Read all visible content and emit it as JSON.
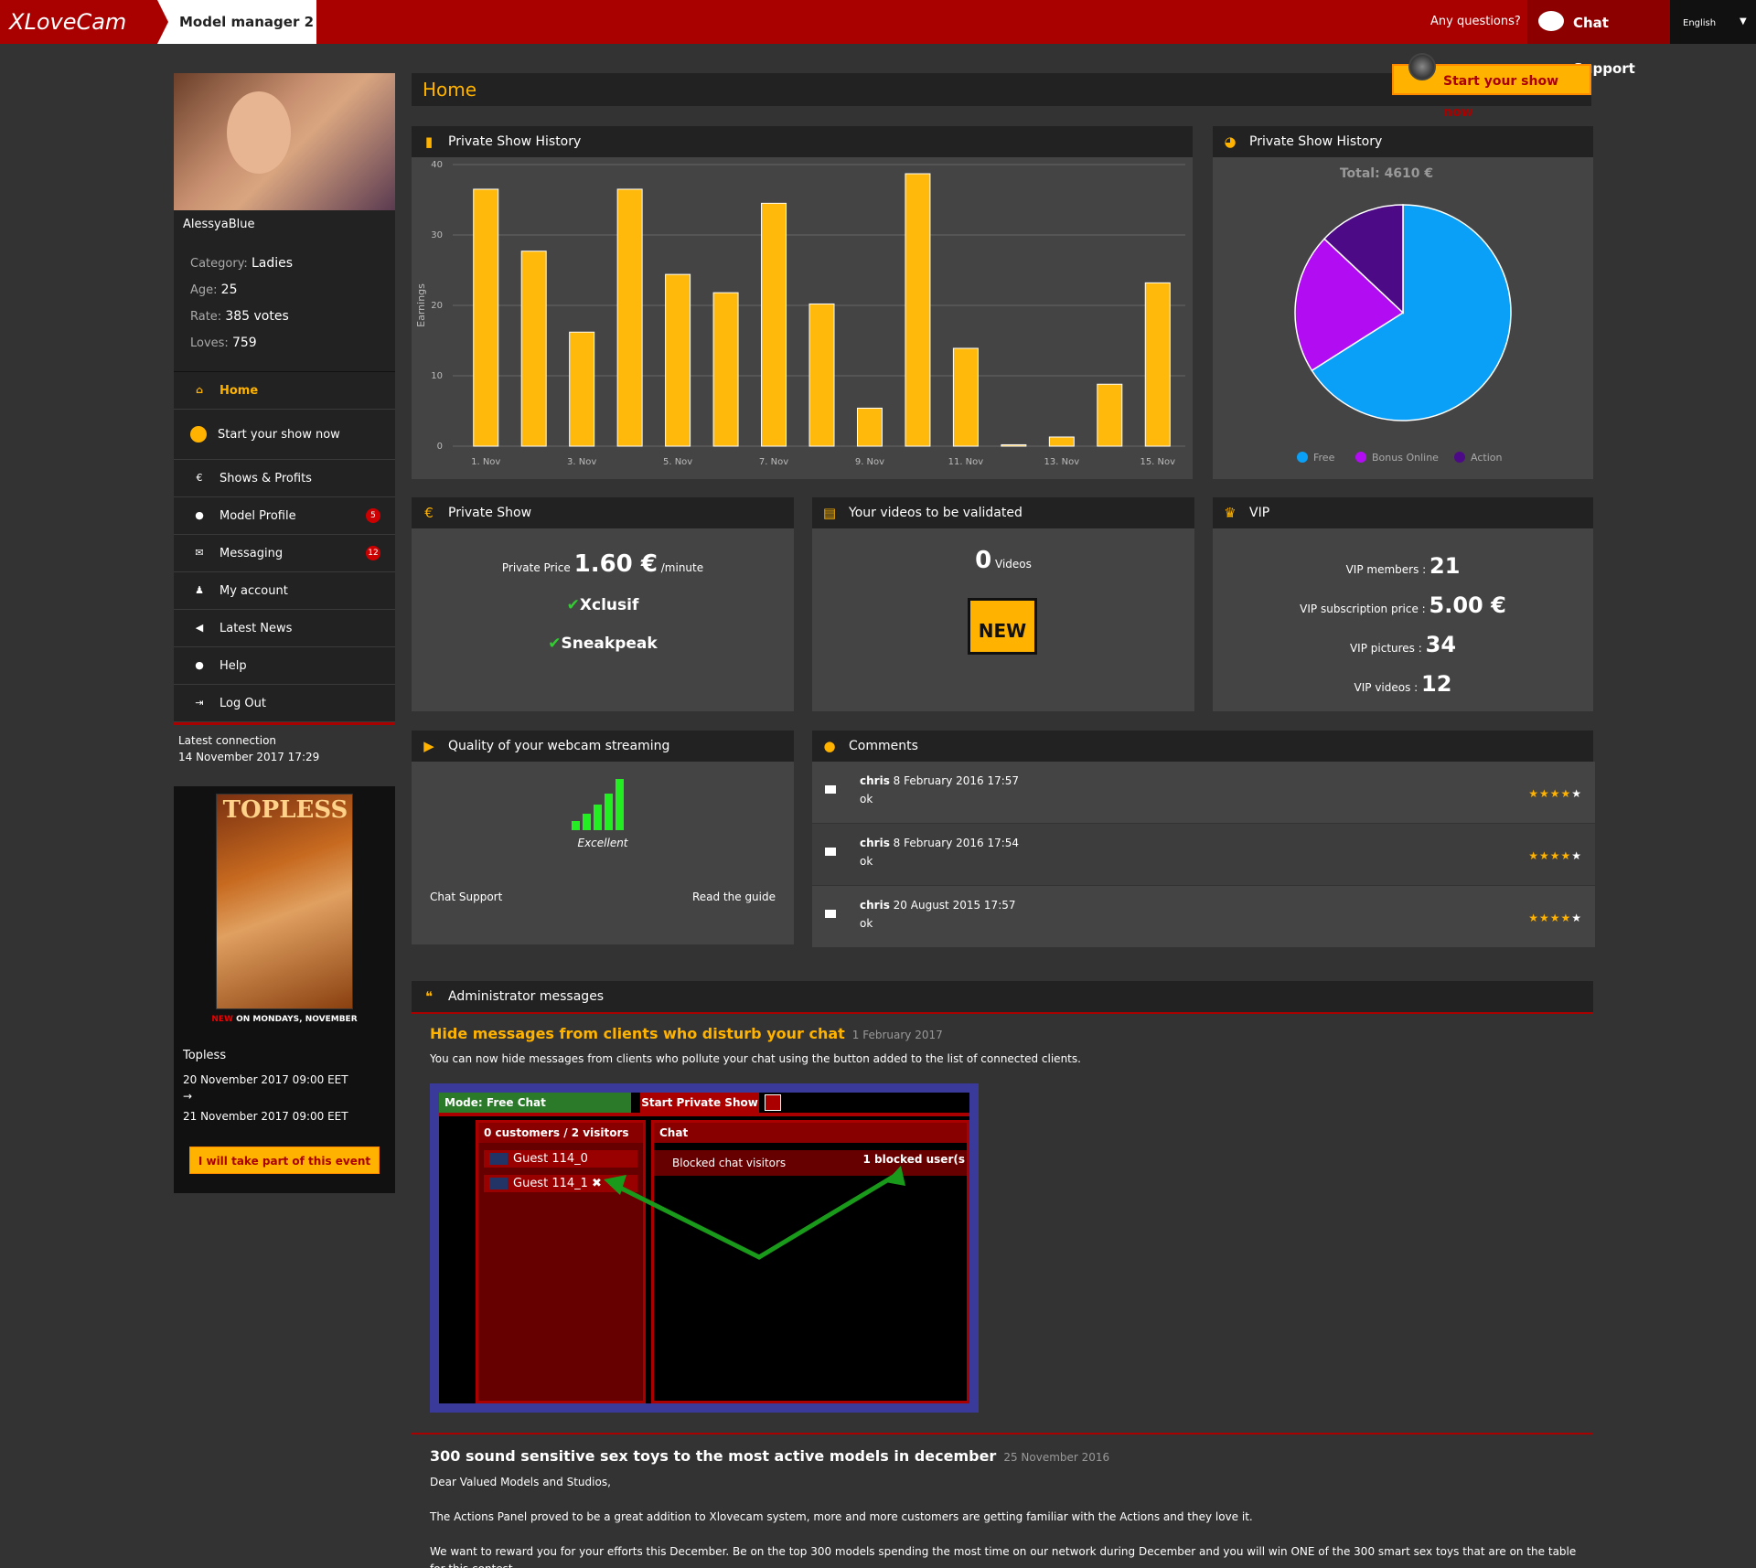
{
  "header": {
    "logo": "XLoveCam",
    "tab": "Model manager 2",
    "any_questions": "Any questions?",
    "chat_support": "Chat Support",
    "language": "English"
  },
  "profile": {
    "name": "AlessyaBlue",
    "category_label": "Category:",
    "category": "Ladies",
    "age_label": "Age:",
    "age": "25",
    "rate_label": "Rate:",
    "rate": "385 votes",
    "loves_label": "Loves:",
    "loves": "759"
  },
  "nav": [
    {
      "label": "Home",
      "icon": "home-icon"
    },
    {
      "label": "Start your show now",
      "icon": "webcam-icon"
    },
    {
      "label": "Shows & Profits",
      "icon": "euro-icon"
    },
    {
      "label": "Model Profile",
      "icon": "circle-icon",
      "badge": "5"
    },
    {
      "label": "Messaging",
      "icon": "envelope-icon",
      "badge": "12"
    },
    {
      "label": "My account",
      "icon": "user-icon"
    },
    {
      "label": "Latest News",
      "icon": "megaphone-icon"
    },
    {
      "label": "Help",
      "icon": "help-icon"
    },
    {
      "label": "Log Out",
      "icon": "logout-icon"
    }
  ],
  "last_connection": {
    "label": "Latest connection",
    "value": "14 November 2017 17:29"
  },
  "event": {
    "poster_title": "TOPLESS",
    "new_tag": "NEW",
    "new_text": "ON MONDAYS, NOVEMBER",
    "title": "Topless",
    "start": "20 November 2017 09:00 EET",
    "arrow": "→",
    "end": "21 November 2017 09:00 EET",
    "button": "I will take part of this event"
  },
  "main": {
    "title": "Home",
    "start_show": "Start your show now"
  },
  "bar_panel": {
    "title": "Private Show History",
    "ylabel": "Earnings"
  },
  "pie_panel": {
    "title": "Private Show History",
    "total": "Total: 4610 €"
  },
  "chart_data": [
    {
      "type": "bar",
      "title": "Private Show History",
      "ylabel": "Earnings",
      "xlabel": "",
      "ylim": [
        0,
        40
      ],
      "yticks": [
        0,
        10,
        20,
        30,
        40
      ],
      "categories": [
        "1. Nov",
        "2. Nov",
        "3. Nov",
        "4. Nov",
        "5. Nov",
        "6. Nov",
        "7. Nov",
        "8. Nov",
        "9. Nov",
        "10. Nov",
        "11. Nov",
        "12. Nov",
        "13. Nov",
        "14. Nov",
        "15. Nov"
      ],
      "tick_labels": [
        "1. Nov",
        "3. Nov",
        "5. Nov",
        "7. Nov",
        "9. Nov",
        "11. Nov",
        "13. Nov",
        "15. Nov"
      ],
      "values": [
        36.5,
        27.7,
        16.2,
        36.5,
        24.4,
        21.8,
        34.5,
        20.2,
        5.4,
        38.7,
        13.9,
        0.2,
        1.3,
        8.8,
        23.2
      ],
      "color": "#ffb90a",
      "grid": true
    },
    {
      "type": "pie",
      "title": "Total: 4610 €",
      "legend_placement": "bottom",
      "series": [
        {
          "name": "Free",
          "value": 66,
          "color": "#0aa0f7"
        },
        {
          "name": "Bonus Online",
          "value": 21,
          "color": "#b20df2"
        },
        {
          "name": "Action",
          "value": 13,
          "color": "#4d0a86"
        }
      ]
    }
  ],
  "private_show": {
    "title": "Private Show",
    "price_label": "Private Price",
    "price": "1.60 €",
    "unit": "/minute",
    "opt1": "Xclusif",
    "opt2": "Sneakpeak"
  },
  "videos": {
    "title": "Your videos to be validated",
    "count": "0",
    "label": "Videos",
    "badge": "NEW"
  },
  "vip": {
    "title": "VIP",
    "members_label": "VIP members :",
    "members": "21",
    "price_label": "VIP subscription price :",
    "price": "5.00 €",
    "pictures_label": "VIP pictures :",
    "pictures": "34",
    "videos_label": "VIP videos :",
    "videos": "12"
  },
  "quality": {
    "title": "Quality of your webcam streaming",
    "level": "Excellent",
    "bars_filled": 5,
    "chat_support": "Chat Support",
    "guide": "Read the guide"
  },
  "comments": {
    "title": "Comments",
    "items": [
      {
        "author": "chris",
        "date": "8 February 2016 17:57",
        "text": "ok",
        "rating": 4
      },
      {
        "author": "chris",
        "date": "8 February 2016 17:54",
        "text": "ok",
        "rating": 4
      },
      {
        "author": "chris",
        "date": "20 August 2015 17:57",
        "text": "ok",
        "rating": 4
      }
    ]
  },
  "admin": {
    "title": "Administrator messages",
    "msg1": {
      "title": "Hide messages from clients who disturb your chat",
      "date": "1 February 2017",
      "body": "You can now hide messages from clients who pollute your chat using the button added to the list of connected clients."
    },
    "shot": {
      "mode": "Mode:  Free Chat",
      "start_private": "Start Private Show",
      "customers": "0 customers / 2 visitors",
      "chat": "Chat",
      "guest1": "Guest 114_0",
      "guest2": "Guest 114_1",
      "blocked": "Blocked chat visitors",
      "blocked_count": "1 blocked user(s"
    },
    "msg2": {
      "title": "300 sound sensitive sex toys to the most active models in december",
      "date": "25 November 2016",
      "p1": "Dear Valued Models and Studios,",
      "p2": "The Actions Panel proved to be a great addition to Xlovecam system, more and more customers are getting familiar with the Actions and they love it.",
      "p3": "We want to reward you for your efforts this December. Be on the top 300 models spending the most time on our network during December and you will win ONE of the 300 smart sex toys that are on the table for this contest."
    }
  }
}
